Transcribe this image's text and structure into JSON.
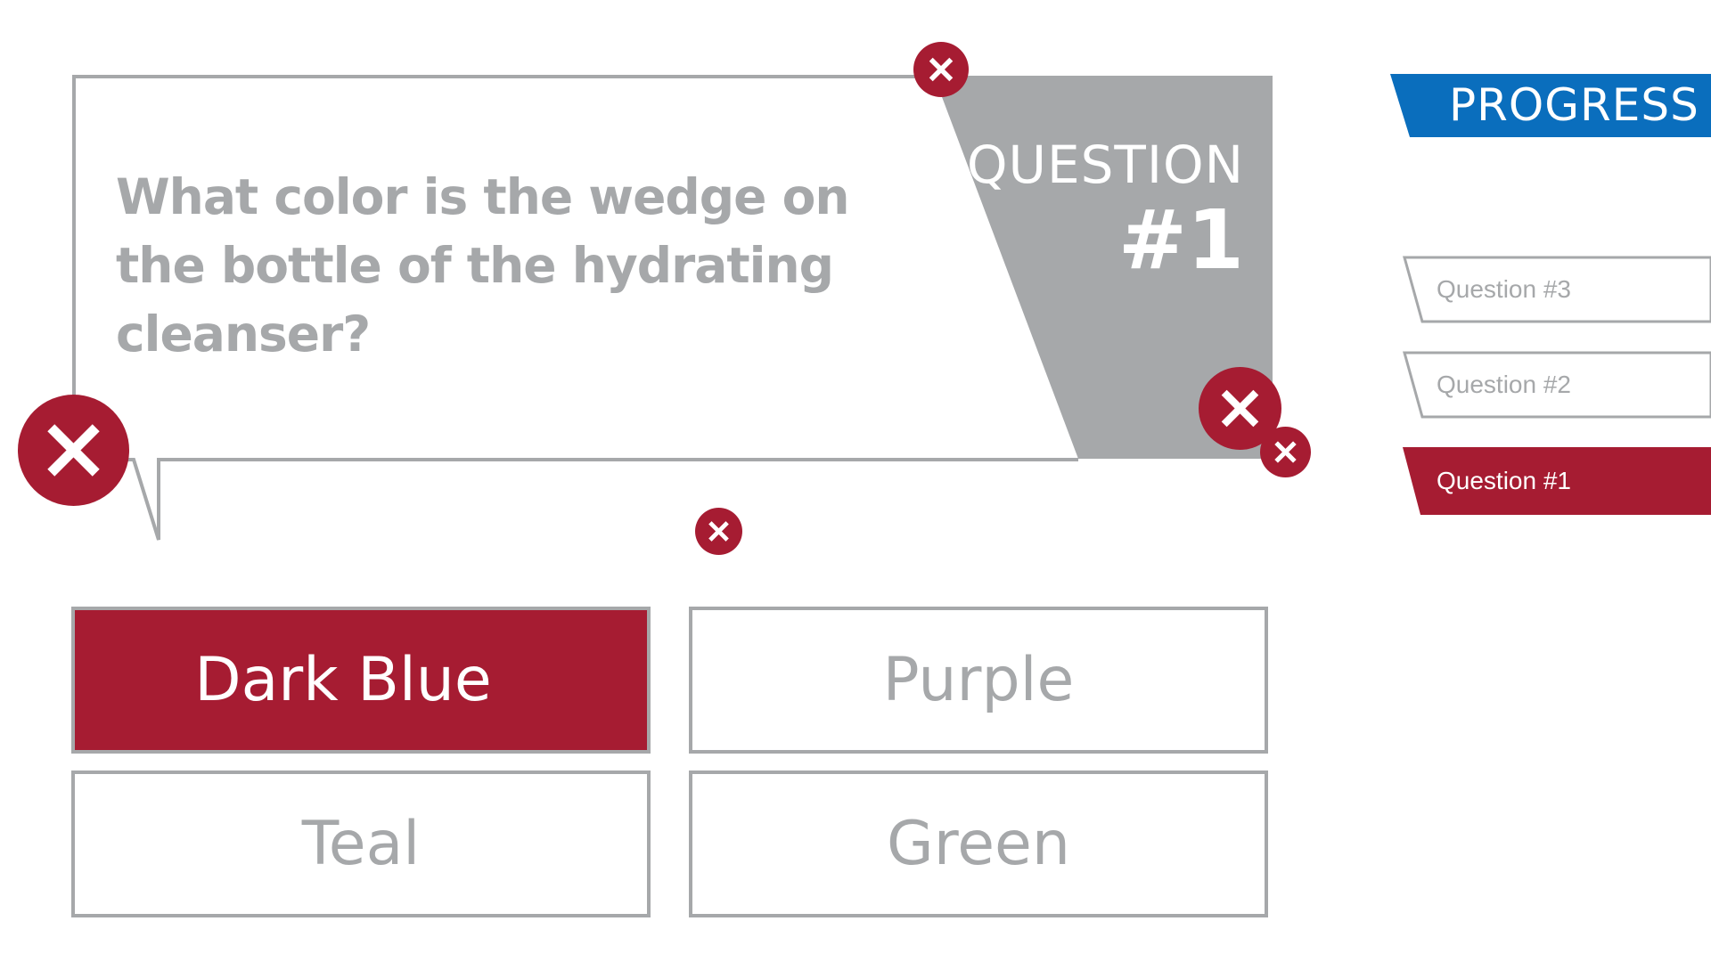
{
  "question": {
    "text": "What color is the wedge on the bottle of the hydrating cleanser?",
    "label_line1": "QUESTION",
    "label_line2": "#1"
  },
  "answers": [
    {
      "label": "Dark Blue",
      "selected": true
    },
    {
      "label": "Purple",
      "selected": false
    },
    {
      "label": "Teal",
      "selected": false
    },
    {
      "label": "Green",
      "selected": false
    }
  ],
  "progress": {
    "title": "PROGRESS",
    "items": [
      {
        "label": "Question #3",
        "active": false
      },
      {
        "label": "Question #2",
        "active": false
      },
      {
        "label": "Question #1",
        "active": true
      }
    ]
  },
  "colors": {
    "accent_red": "#a61c32",
    "gray": "#a6a8aa",
    "progress_blue": "#0a6ebd"
  },
  "icons": {
    "close": "close-icon"
  }
}
